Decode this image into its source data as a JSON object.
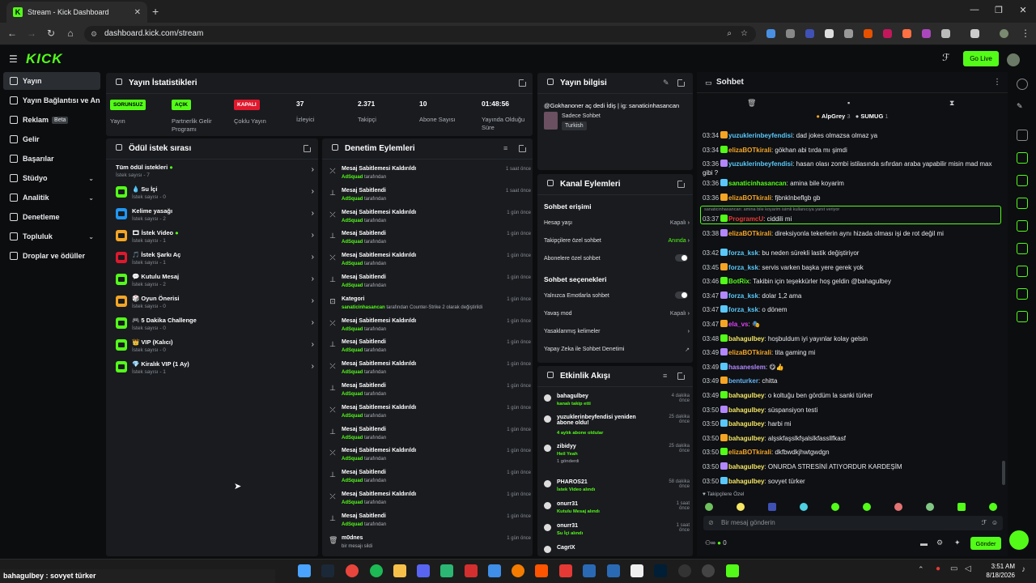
{
  "browser": {
    "tab_title": "Stream - Kick Dashboard",
    "url": "dashboard.kick.com/stream"
  },
  "app": {
    "logo": "KICK",
    "go_live": "Go Live"
  },
  "sidebar": {
    "items": [
      {
        "label": "Yayın"
      },
      {
        "label": "Yayın Bağlantısı ve Anahtarı"
      },
      {
        "label": "Reklam",
        "badge": "Beta"
      },
      {
        "label": "Gelir"
      },
      {
        "label": "Başarılar"
      },
      {
        "label": "Stüdyo"
      },
      {
        "label": "Analitik"
      },
      {
        "label": "Denetleme"
      },
      {
        "label": "Topluluk"
      },
      {
        "label": "Droplar ve ödüller"
      }
    ]
  },
  "stats": {
    "title": "Yayın İstatistikleri",
    "items": [
      {
        "badge": "SORUNSUZ",
        "label": "Yayın"
      },
      {
        "badge": "AÇIK",
        "label": "Partnerlik Gelir Programı"
      },
      {
        "badge": "KAPALI",
        "label": "Çoklu Yayın"
      },
      {
        "value": "37",
        "label": "İzleyici"
      },
      {
        "value": "2.371",
        "label": "Takipçi"
      },
      {
        "value": "10",
        "label": "Abone Sayısı"
      },
      {
        "value": "01:48:56",
        "label": "Yayında Olduğu Süre"
      }
    ]
  },
  "stream_info": {
    "title": "Yayın bilgisi",
    "text": "@Gokhanoner aç dedi İdiş | ig: sanaticinhasancan",
    "category": "Sadece Sohbet",
    "language": "Turkish"
  },
  "rewards": {
    "title": "Ödül istek sırası",
    "items": [
      {
        "name": "Tüm ödül istekleri",
        "count": "İstek sayısı - 7"
      },
      {
        "name": "💧 Su İçi",
        "count": "İstek sayısı - 0"
      },
      {
        "name": "Kelime yasağı",
        "count": "İstek sayısı - 2"
      },
      {
        "name": "🎞 İstek Video",
        "count": "İstek sayısı - 1"
      },
      {
        "name": "🎵 İstek Şarkı Aç",
        "count": "İstek sayısı - 1"
      },
      {
        "name": "💬 Kutulu Mesaj",
        "count": "İstek sayısı - 2"
      },
      {
        "name": "🎲 Oyun Önerisi",
        "count": "İstek sayısı - 0"
      },
      {
        "name": "🎮 5 Dakika Challenge",
        "count": "İstek sayısı - 0"
      },
      {
        "name": "👑 VIP (Kalıcı)",
        "count": "İstek sayısı - 0"
      },
      {
        "name": "💎 Kiralık VIP (1 Ay)",
        "count": "İstek sayısı - 1"
      }
    ]
  },
  "moderation": {
    "title": "Denetim Eylemleri",
    "items": [
      {
        "icon": "unpin",
        "title": "Mesaj Sabitlemesi Kaldırıldı",
        "by": "AdSquad",
        "suffix": "tarafından",
        "time": "1 saat önce"
      },
      {
        "icon": "pin",
        "title": "Mesaj Sabitlendi",
        "by": "AdSquad",
        "suffix": "tarafından",
        "time": "1 saat önce"
      },
      {
        "icon": "unpin",
        "title": "Mesaj Sabitlemesi Kaldırıldı",
        "by": "AdSquad",
        "suffix": "tarafından",
        "time": "1 gün önce"
      },
      {
        "icon": "pin",
        "title": "Mesaj Sabitlendi",
        "by": "AdSquad",
        "suffix": "tarafından",
        "time": "1 gün önce"
      },
      {
        "icon": "unpin",
        "title": "Mesaj Sabitlemesi Kaldırıldı",
        "by": "AdSquad",
        "suffix": "tarafından",
        "time": "1 gün önce"
      },
      {
        "icon": "pin",
        "title": "Mesaj Sabitlendi",
        "by": "AdSquad",
        "suffix": "tarafından",
        "time": "1 gün önce"
      },
      {
        "icon": "category",
        "title": "Kategori",
        "by": "sanaticinhasancan",
        "suffix": "tarafından Counter-Strike 2 olarak değiştirildi",
        "time": "1 gün önce"
      },
      {
        "icon": "unpin",
        "title": "Mesaj Sabitlemesi Kaldırıldı",
        "by": "AdSquad",
        "suffix": "tarafından",
        "time": "1 gün önce"
      },
      {
        "icon": "pin",
        "title": "Mesaj Sabitlendi",
        "by": "AdSquad",
        "suffix": "tarafından",
        "time": "1 gün önce"
      },
      {
        "icon": "unpin",
        "title": "Mesaj Sabitlemesi Kaldırıldı",
        "by": "AdSquad",
        "suffix": "tarafından",
        "time": "1 gün önce"
      },
      {
        "icon": "pin",
        "title": "Mesaj Sabitlendi",
        "by": "AdSquad",
        "suffix": "tarafından",
        "time": "1 gün önce"
      },
      {
        "icon": "unpin",
        "title": "Mesaj Sabitlemesi Kaldırıldı",
        "by": "AdSquad",
        "suffix": "tarafından",
        "time": "1 gün önce"
      },
      {
        "icon": "pin",
        "title": "Mesaj Sabitlendi",
        "by": "AdSquad",
        "suffix": "tarafından",
        "time": "1 gün önce"
      },
      {
        "icon": "unpin",
        "title": "Mesaj Sabitlemesi Kaldırıldı",
        "by": "AdSquad",
        "suffix": "tarafından",
        "time": "1 gün önce"
      },
      {
        "icon": "pin",
        "title": "Mesaj Sabitlendi",
        "by": "AdSquad",
        "suffix": "tarafından",
        "time": "1 gün önce"
      },
      {
        "icon": "unpin",
        "title": "Mesaj Sabitlemesi Kaldırıldı",
        "by": "AdSquad",
        "suffix": "tarafından",
        "time": "1 gün önce"
      },
      {
        "icon": "pin",
        "title": "Mesaj Sabitlendi",
        "by": "AdSquad",
        "suffix": "tarafından",
        "time": "1 gün önce"
      },
      {
        "icon": "trash",
        "title": "m0dnes",
        "by": "",
        "suffix": "bir mesajı sildi",
        "time": "1 gün önce"
      }
    ]
  },
  "channel_actions": {
    "title": "Kanal Eylemleri",
    "chat_access": "Sohbet erişimi",
    "rows1": [
      {
        "label": "Hesap yaşı",
        "value": "Kapalı",
        "type": "arrow"
      },
      {
        "label": "Takipçilere özel sohbet",
        "value": "Anında",
        "type": "arrow-green"
      },
      {
        "label": "Abonelere özel sohbet",
        "value": "",
        "type": "toggle"
      }
    ],
    "chat_options": "Sohbet seçenekleri",
    "rows2": [
      {
        "label": "Yalnızca Emotlarla sohbet",
        "value": "",
        "type": "toggle"
      },
      {
        "label": "Yavaş mod",
        "value": "Kapalı",
        "type": "arrow"
      },
      {
        "label": "Yasaklanmış kelimeler",
        "value": "",
        "type": "arrow"
      },
      {
        "label": "Yapay Zeka ile Sohbet Denetimi",
        "value": "",
        "type": "external"
      }
    ]
  },
  "activity": {
    "title": "Etkinlik Akışı",
    "items": [
      {
        "name": "bahagulbey",
        "sub": "kanalı takip etti",
        "time": "4 dakika önce"
      },
      {
        "name": "yuzuklerinbeyfendisi yeniden abone oldu!",
        "sub": "4 aylık abone oldular",
        "time": "25 dakika önce"
      },
      {
        "name": "zibidyy",
        "sub": "Heil Yeah",
        "sub2": "1 gönderdi",
        "time": "25 dakika önce"
      },
      {
        "name": "PHAROS21",
        "sub": "İstek Video alındı",
        "time": "58 dakika önce"
      },
      {
        "name": "onurr31",
        "sub": "Kutulu Mesaj alındı",
        "time": "1 saat önce"
      },
      {
        "name": "onurr31",
        "sub": "Su İçi alındı",
        "time": "1 saat önce"
      },
      {
        "name": "CagrIX",
        "sub": "",
        "time": ""
      }
    ]
  },
  "chat": {
    "title": "Sohbet",
    "top_users": [
      {
        "name": "AlpGrey",
        "count": "3"
      },
      {
        "name": "SUMUG",
        "count": "1"
      }
    ],
    "messages": [
      {
        "time": "03:34",
        "user": "yuzuklerinbeyfendisi",
        "color": "#5ac8fa",
        "text": ": dad jokes olmazsa olmaz ya"
      },
      {
        "time": "03:34",
        "user": "elizaBOTkirali",
        "color": "#f5a524",
        "text": ": gökhan abi tırda mı şimdi"
      },
      {
        "time": "03:36",
        "user": "yuzuklerinbeyfendisi",
        "color": "#5ac8fa",
        "text": ": hasan olası zombi istilasında sıfırdan araba yapabilir misin mad max gibi ?"
      },
      {
        "time": "03:36",
        "user": "sanaticinhasancan",
        "color": "#53fc18",
        "text": ": amina bile koyarim"
      },
      {
        "time": "03:36",
        "user": "elizaBOTkirali",
        "color": "#f5a524",
        "text": ": fjbnklnbeflgb gb"
      },
      {
        "time": "03:37",
        "user": "ProgramcU",
        "color": "#e53935",
        "text": ": ciddili mi",
        "reply": "sanaticinhasancan: amina bile koyarim isimli kullanıcıya yanıt veriyor"
      },
      {
        "time": "03:38",
        "user": "elizaBOTkirali",
        "color": "#f5a524",
        "text": ": direksiyonla tekerlerin aynı hizada olması işi de rot değil mi"
      },
      {
        "time": "03:42",
        "user": "forza_ksk",
        "color": "#5ac8fa",
        "text": ": bu neden sürekli lastik değiştiriyor"
      },
      {
        "time": "03:45",
        "user": "forza_ksk",
        "color": "#5ac8fa",
        "text": ": servis varken başka yere gerek yok"
      },
      {
        "time": "03:46",
        "user": "BotRix",
        "color": "#53fc18",
        "text": ": Takibin için teşekkürler hoş geldin @bahagulbey"
      },
      {
        "time": "03:47",
        "user": "forza_ksk",
        "color": "#5ac8fa",
        "text": ": dolar 1,2 ama"
      },
      {
        "time": "03:47",
        "user": "forza_ksk",
        "color": "#5ac8fa",
        "text": ": o dönem"
      },
      {
        "time": "03:47",
        "user": "ela_vs",
        "color": "#e040fb",
        "text": ": 🎭"
      },
      {
        "time": "03:48",
        "user": "bahagulbey",
        "color": "#f5e663",
        "text": ": hoşbuldum iyi yayınlar kolay gelsin"
      },
      {
        "time": "03:49",
        "user": "elizaBOTkirali",
        "color": "#f5a524",
        "text": ": tita gaming mi"
      },
      {
        "time": "03:49",
        "user": "hasaneslem",
        "color": "#b388ff",
        "text": ": 😋👍"
      },
      {
        "time": "03:49",
        "user": "benturker",
        "color": "#64b5f6",
        "text": ": chitta"
      },
      {
        "time": "03:49",
        "user": "bahagulbey",
        "color": "#f5e663",
        "text": ": o koltuğu ben gördüm la sanki türker"
      },
      {
        "time": "03:50",
        "user": "bahagulbey",
        "color": "#f5e663",
        "text": ": süspansiyon testi"
      },
      {
        "time": "03:50",
        "user": "bahagulbey",
        "color": "#f5e663",
        "text": ": harbi mi"
      },
      {
        "time": "03:50",
        "user": "bahagulbey",
        "color": "#f5e663",
        "text": ": alşskfaşslkfşalslkfassllfkasf"
      },
      {
        "time": "03:50",
        "user": "elizaBOTkirali",
        "color": "#f5a524",
        "text": ": dkfbwdkjhwtgwdgn"
      },
      {
        "time": "03:50",
        "user": "bahagulbey",
        "color": "#f5e663",
        "text": ": ONURDA STRESİNİ ATIYORDUR KARDEŞİM"
      },
      {
        "time": "03:50",
        "user": "bahagulbey",
        "color": "#f5e663",
        "text": ": sovyet türker"
      }
    ],
    "followers_only": "Takipçilere Özel",
    "placeholder": "Bir mesaj gönderin",
    "viewer_count": "0",
    "send": "Gönder"
  },
  "taskbar": {
    "toast": "bahagulbey : sovyet türker",
    "time": "3:51 AM",
    "date": "8/18/2026"
  },
  "colors": {
    "accent": "#53fc18",
    "panel": "#191b1f",
    "bg": "#0b0d0f"
  }
}
